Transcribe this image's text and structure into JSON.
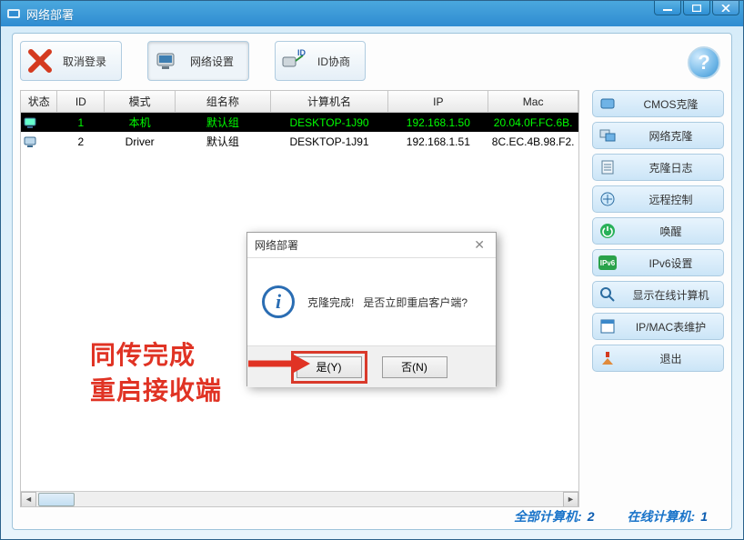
{
  "window": {
    "title": "网络部署"
  },
  "toolbar": {
    "cancel_login": "取消登录",
    "net_settings": "网络设置",
    "id_negotiate": "ID协商"
  },
  "table": {
    "headers": [
      "状态",
      "ID",
      "模式",
      "组名称",
      "计算机名",
      "IP",
      "Mac"
    ],
    "rows": [
      {
        "selected": true,
        "id": "1",
        "mode": "本机",
        "group": "默认组",
        "host": "DESKTOP-1J90",
        "ip": "192.168.1.50",
        "mac": "20.04.0F.FC.6B."
      },
      {
        "selected": false,
        "id": "2",
        "mode": "Driver",
        "group": "默认组",
        "host": "DESKTOP-1J91",
        "ip": "192.168.1.51",
        "mac": "8C.EC.4B.98.F2."
      }
    ]
  },
  "side": {
    "items": [
      {
        "label": "CMOS克隆",
        "icon": "cmos"
      },
      {
        "label": "网络克隆",
        "icon": "netclone"
      },
      {
        "label": "克隆日志",
        "icon": "log"
      },
      {
        "label": "远程控制",
        "icon": "remote"
      },
      {
        "label": "唤醒",
        "icon": "power"
      },
      {
        "label": "IPv6设置",
        "icon": "ipv6"
      },
      {
        "label": "显示在线计算机",
        "icon": "search"
      },
      {
        "label": "IP/MAC表维护",
        "icon": "table"
      },
      {
        "label": "退出",
        "icon": "exit"
      }
    ]
  },
  "status": {
    "total_label": "全部计算机:",
    "total": "2",
    "online_label": "在线计算机:",
    "online": "1"
  },
  "dialog": {
    "title": "网络部署",
    "msg_a": "克隆完成!",
    "msg_b": "是否立即重启客户端?",
    "yes": "是(Y)",
    "no": "否(N)"
  },
  "annotation": {
    "line1": "同传完成",
    "line2": "重启接收端"
  }
}
